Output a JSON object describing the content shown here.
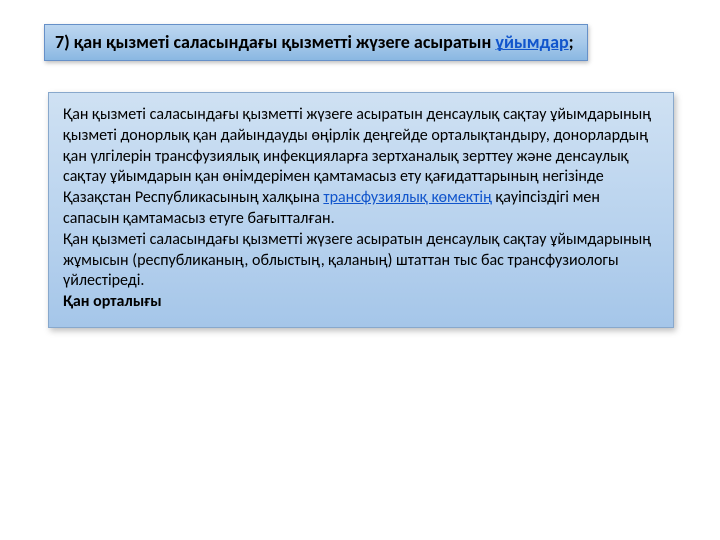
{
  "heading": {
    "pre": "7) қан қызметi саласындағы қызметтi жүзеге асыратын ",
    "link": "ұйымдар",
    "post": ";"
  },
  "body": {
    "p1_pre": "Қан қызметi саласындағы қызметтi жүзеге асыратын денсаулық сақтау ұйымдарының қызметі донорлық қан дайындауды өңірлік деңгейде орталықтандыру, донорлардың қан үлгілерін трансфузиялық инфекцияларға зертханалық зерттеу және денсаулық сақтау ұйымдарын қан өнімдерімен қамтамасыз ету қағидаттарының негізінде Қазақстан Республикасының халқына ",
    "p1_link": "трансфузиялық көмектің",
    "p1_post": " қауіпсіздігі мен сапасын қамтамасыз етуге бағытталған.",
    "p2": " Қан қызметi саласындағы қызметтi жүзеге асыратын денсаулық сақтау ұйымдарының жұмысын (республиканың, облыстың, қаланың) штаттан тыс бас трансфузиологы үйлестіреді.",
    "p3": "Қан орталығы"
  }
}
